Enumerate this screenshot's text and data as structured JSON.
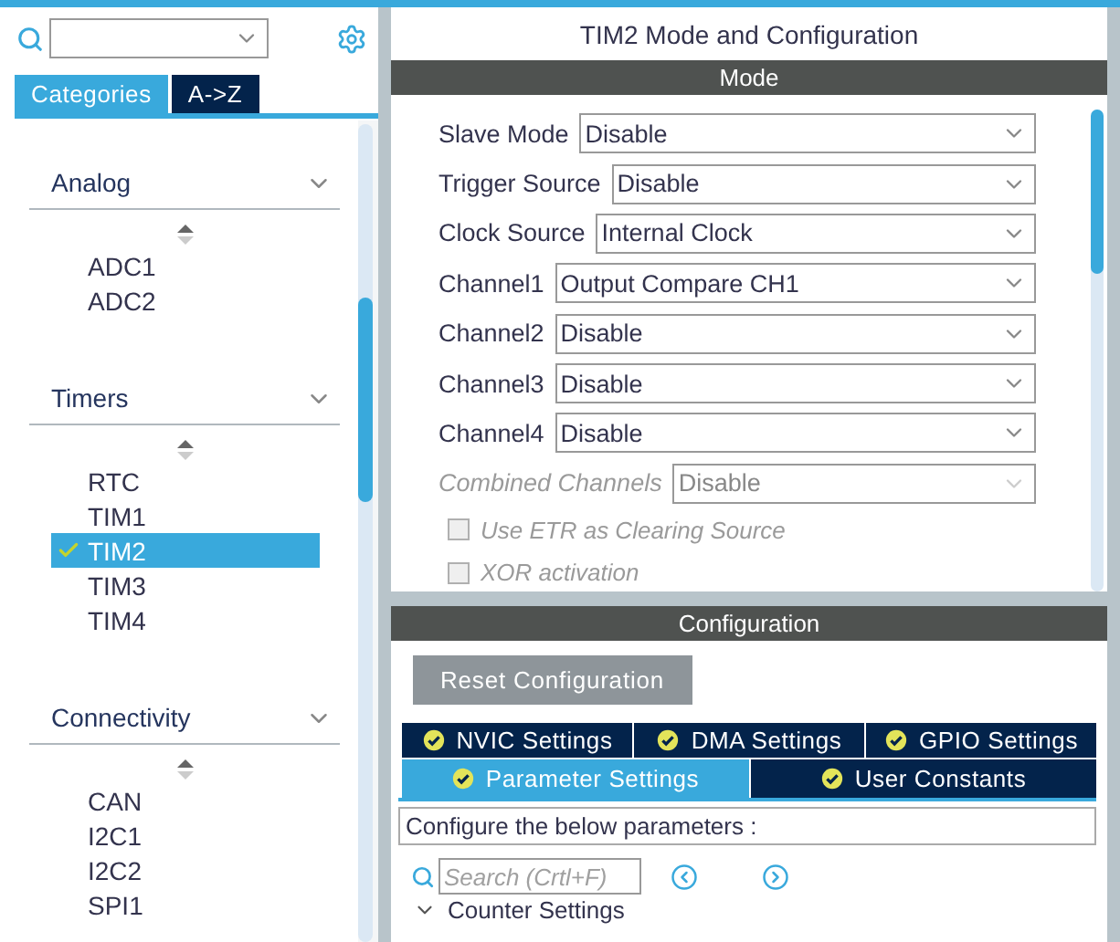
{
  "tabs": [
    {
      "label": "Categories",
      "selected": true
    },
    {
      "label": "A->Z",
      "selected": false
    }
  ],
  "categories": [
    {
      "label": "Analog",
      "expanded": true,
      "items": [
        {
          "label": "ADC1",
          "selected": false,
          "configured": false
        },
        {
          "label": "ADC2",
          "selected": false,
          "configured": false
        }
      ]
    },
    {
      "label": "Timers",
      "expanded": true,
      "items": [
        {
          "label": "RTC",
          "selected": false,
          "configured": false
        },
        {
          "label": "TIM1",
          "selected": false,
          "configured": false
        },
        {
          "label": "TIM2",
          "selected": true,
          "configured": true
        },
        {
          "label": "TIM3",
          "selected": false,
          "configured": false
        },
        {
          "label": "TIM4",
          "selected": false,
          "configured": false
        }
      ]
    },
    {
      "label": "Connectivity",
      "expanded": true,
      "items": [
        {
          "label": "CAN",
          "selected": false,
          "configured": false
        },
        {
          "label": "I2C1",
          "selected": false,
          "configured": false
        },
        {
          "label": "I2C2",
          "selected": false,
          "configured": false
        },
        {
          "label": "SPI1",
          "selected": false,
          "configured": false
        }
      ]
    }
  ],
  "title": "TIM2 Mode and Configuration",
  "mode": {
    "header": "Mode",
    "fields": [
      {
        "kind": "select",
        "label": "Slave Mode",
        "value": "Disable",
        "disabled": false
      },
      {
        "kind": "select",
        "label": "Trigger Source",
        "value": "Disable",
        "disabled": false
      },
      {
        "kind": "select",
        "label": "Clock Source",
        "value": "Internal Clock",
        "disabled": false
      },
      {
        "kind": "select",
        "label": "Channel1",
        "value": "Output Compare CH1",
        "disabled": false
      },
      {
        "kind": "select",
        "label": "Channel2",
        "value": "Disable",
        "disabled": false
      },
      {
        "kind": "select",
        "label": "Channel3",
        "value": "Disable",
        "disabled": false
      },
      {
        "kind": "select",
        "label": "Channel4",
        "value": "Disable",
        "disabled": false
      },
      {
        "kind": "select",
        "label": "Combined Channels",
        "value": "Disable",
        "disabled": true
      },
      {
        "kind": "checkbox",
        "label": "Use ETR as Clearing Source",
        "checked": false,
        "disabled": true
      },
      {
        "kind": "checkbox",
        "label": "XOR activation",
        "checked": false,
        "disabled": true
      }
    ]
  },
  "configuration": {
    "header": "Configuration",
    "reset_button": "Reset Configuration",
    "tab_rows": [
      [
        {
          "label": "NVIC Settings",
          "selected": false
        },
        {
          "label": "DMA Settings",
          "selected": false
        },
        {
          "label": "GPIO Settings",
          "selected": false
        }
      ],
      [
        {
          "label": "Parameter Settings",
          "selected": true
        },
        {
          "label": "User Constants",
          "selected": false
        }
      ]
    ],
    "description": "Configure the below parameters :",
    "search": {
      "placeholder": "Search (Crtl+F)"
    },
    "section": {
      "label": "Counter Settings",
      "expanded": true
    }
  }
}
